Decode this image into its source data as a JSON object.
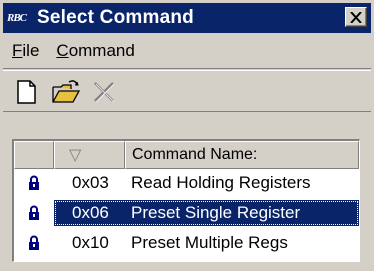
{
  "window": {
    "app_icon_text": "RBC",
    "title": "Select Command",
    "close_glyph": "✕"
  },
  "menu": {
    "items": [
      {
        "accel": "F",
        "rest": "ile"
      },
      {
        "accel": "C",
        "rest": "ommand"
      }
    ]
  },
  "toolbar": {
    "buttons": [
      {
        "icon": "new-document-icon",
        "enabled": true
      },
      {
        "icon": "open-folder-icon",
        "enabled": true
      },
      {
        "icon": "delete-x-icon",
        "enabled": false
      }
    ]
  },
  "grid": {
    "headers": {
      "col1": "",
      "col2_sort_glyph": "▽",
      "col3": "Command Name:"
    },
    "rows": [
      {
        "icon": "lock-icon",
        "id": "0x03",
        "name": "Read Holding Registers",
        "selected": false
      },
      {
        "icon": "lock-icon",
        "id": "0x06",
        "name": "Preset Single Register",
        "selected": true
      },
      {
        "icon": "lock-icon",
        "id": "0x10",
        "name": "Preset Multiple Regs",
        "selected": false
      }
    ]
  },
  "colors": {
    "titlebar": "#0a246a",
    "face": "#d4d0c8",
    "selection": "#0a246a",
    "folder": "#e8c040"
  }
}
